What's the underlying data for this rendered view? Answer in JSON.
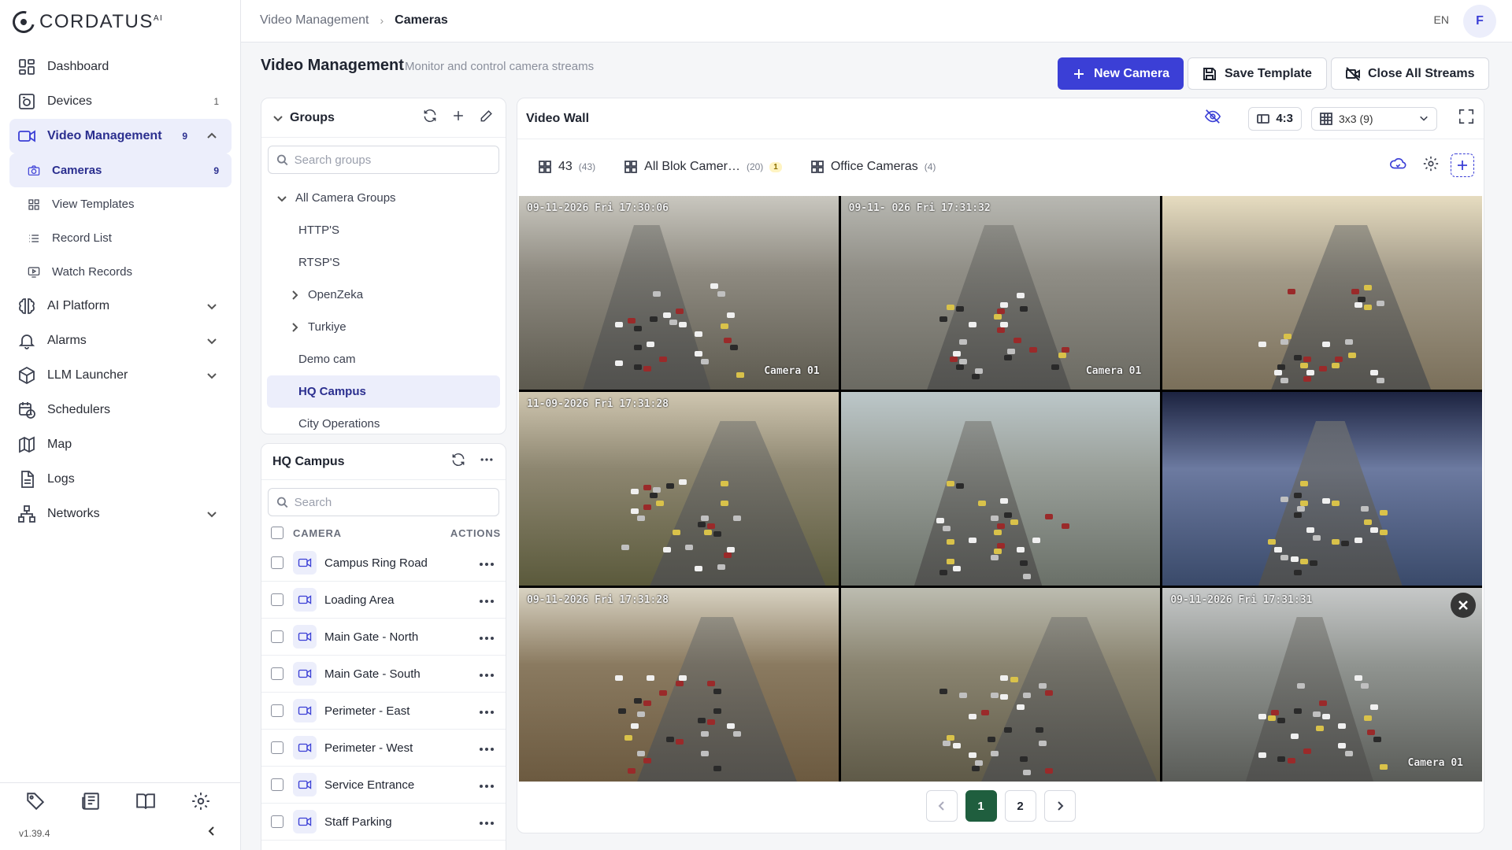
{
  "brand": {
    "name": "CORDATUS",
    "sup": "AI"
  },
  "version": "v1.39.4",
  "nav": {
    "items": [
      {
        "label": "Dashboard",
        "icon": "dashboard-icon"
      },
      {
        "label": "Devices",
        "icon": "devices-icon",
        "badge": "1"
      },
      {
        "label": "Video Management",
        "icon": "video-icon",
        "badge": "9",
        "expanded": true
      },
      {
        "label": "AI Platform",
        "icon": "brain-icon"
      },
      {
        "label": "Alarms",
        "icon": "bell-icon"
      },
      {
        "label": "LLM Launcher",
        "icon": "cube-icon"
      },
      {
        "label": "Schedulers",
        "icon": "calendar-clock-icon"
      },
      {
        "label": "Map",
        "icon": "map-icon"
      },
      {
        "label": "Logs",
        "icon": "logs-icon"
      },
      {
        "label": "Networks",
        "icon": "network-icon"
      }
    ],
    "sub_items": [
      {
        "label": "Cameras",
        "badge": "9",
        "active": true
      },
      {
        "label": "View Templates"
      },
      {
        "label": "Record List"
      },
      {
        "label": "Watch Records"
      }
    ]
  },
  "topbar": {
    "breadcrumb": [
      "Video Management",
      "Cameras"
    ],
    "language": "EN",
    "avatar_initial": "F"
  },
  "page": {
    "title": "Video Management",
    "subtitle": "Monitor and control camera streams",
    "buttons": {
      "new_camera": "New Camera",
      "save_template": "Save Template",
      "close_all": "Close All Streams"
    }
  },
  "groups": {
    "title": "Groups",
    "search_placeholder": "Search groups",
    "root": "All Camera Groups",
    "items": [
      "HTTP'S",
      "RTSP'S",
      "OpenZeka",
      "Turkiye",
      "Demo cam",
      "HQ Campus",
      "City Operations"
    ],
    "selected": "HQ Campus"
  },
  "hq_panel": {
    "title": "HQ Campus",
    "search_placeholder": "Search",
    "col_camera": "CAMERA",
    "col_actions": "ACTIONS",
    "cameras": [
      "Campus Ring Road",
      "Loading Area",
      "Main Gate - North",
      "Main Gate - South",
      "Perimeter - East",
      "Perimeter - West",
      "Service Entrance",
      "Staff Parking"
    ]
  },
  "wall": {
    "title": "Video Wall",
    "aspect": "4:3",
    "layout": "3x3 (9)",
    "tabs": [
      {
        "label": "43",
        "count": "(43)"
      },
      {
        "label": "All Blok Camer…",
        "count": "(20)",
        "mark": "1"
      },
      {
        "label": "Office Cameras",
        "count": "(4)"
      }
    ],
    "tiles": [
      {
        "ts": "09-11-2026 Fri 17:30:06",
        "cam": "Camera 01"
      },
      {
        "ts": "09-11- 026 Fri 17:31:32",
        "cam": "Camera 01"
      },
      {
        "ts": "",
        "cam": ""
      },
      {
        "ts": "11-09-2026 Fri 17:31:28",
        "cam": ""
      },
      {
        "ts": "",
        "cam": ""
      },
      {
        "ts": "",
        "cam": ""
      },
      {
        "ts": "09-11-2026 Fri 17:31:28",
        "cam": ""
      },
      {
        "ts": "",
        "cam": ""
      },
      {
        "ts": "09-11-2026 Fri 17:31:31",
        "cam": "Camera 01"
      }
    ],
    "pages": [
      "1",
      "2"
    ],
    "current_page": "1"
  },
  "colors": {
    "accent": "#3b3fd6",
    "active_bg": "#eceefb",
    "page_active": "#1f5e3e"
  }
}
